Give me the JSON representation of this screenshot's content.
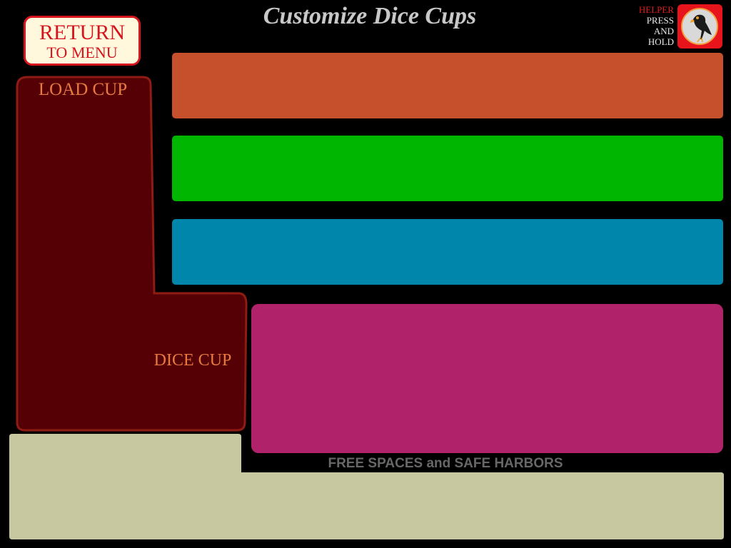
{
  "header": {
    "title": "Customize Dice Cups",
    "return_line1": "RETURN",
    "return_line2": "TO MENU",
    "helper_label": "HELPER",
    "helper_line2": "PRESS",
    "helper_line3": "AND",
    "helper_line4": "HOLD",
    "helper_icon": "parrot-icon"
  },
  "cup": {
    "load_label": "LOAD CUP",
    "dice_label": "DICE CUP",
    "fill_color": "#550005",
    "border_color": "#8e1b14"
  },
  "color_bars": [
    {
      "name": "orange",
      "color": "#c6502b"
    },
    {
      "name": "green",
      "color": "#00b600"
    },
    {
      "name": "blue",
      "color": "#0086aa"
    },
    {
      "name": "magenta",
      "color": "#b0236a"
    }
  ],
  "tray": {
    "label": "FREE SPACES and SAFE HARBORS",
    "color": "#c8c8a0"
  }
}
